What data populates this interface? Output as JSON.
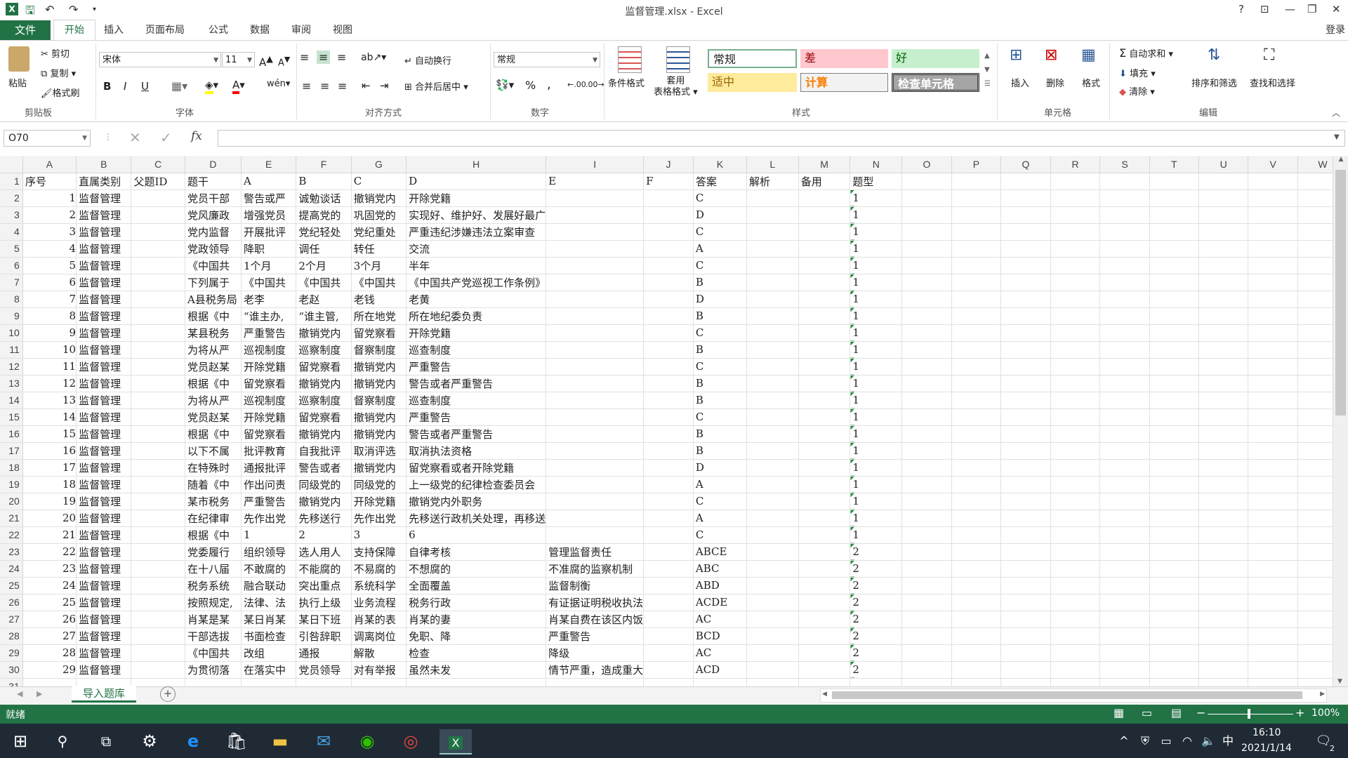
{
  "titlebar": {
    "title": "监督管理.xlsx - Excel",
    "help": "?",
    "minimize": "—",
    "restore": "❐",
    "close": "✕",
    "ribbon_display": "⊡"
  },
  "tabs": {
    "file": "文件",
    "home": "开始",
    "insert": "插入",
    "layout": "页面布局",
    "formulas": "公式",
    "data": "数据",
    "review": "审阅",
    "view": "视图",
    "login": "登录"
  },
  "ribbon": {
    "clipboard": {
      "paste": "粘贴",
      "cut": "剪切",
      "copy": "复制",
      "format_painter": "格式刷",
      "label": "剪贴板"
    },
    "font": {
      "name": "宋体",
      "size": "11",
      "bold": "B",
      "italic": "I",
      "underline": "U",
      "label": "字体",
      "wen": "wén"
    },
    "alignment": {
      "wrap": "自动换行",
      "merge": "合并后居中",
      "label": "对齐方式"
    },
    "number": {
      "format": "常规",
      "percent": "%",
      "comma": ",",
      "label": "数字"
    },
    "styles": {
      "conditional": "条件格式",
      "table_format": "套用\n表格格式",
      "normal": "常规",
      "bad": "差",
      "good": "好",
      "neutral": "适中",
      "calc": "计算",
      "check": "检查单元格",
      "label": "样式"
    },
    "cells": {
      "insert": "插入",
      "delete": "删除",
      "format": "格式",
      "label": "单元格"
    },
    "editing": {
      "autosum": "自动求和",
      "fill": "填充",
      "clear": "清除",
      "sort": "排序和筛选",
      "find": "查找和选择",
      "label": "编辑"
    }
  },
  "formula": {
    "namebox": "O70",
    "value": "",
    "fx": "fx"
  },
  "columns": [
    "A",
    "B",
    "C",
    "D",
    "E",
    "F",
    "G",
    "H",
    "I",
    "J",
    "K",
    "L",
    "M",
    "N",
    "O",
    "P",
    "Q",
    "R",
    "S",
    "T",
    "U",
    "V",
    "W"
  ],
  "header_row": [
    "序号",
    "直属类别",
    "父题ID",
    "题干",
    "A",
    "B",
    "C",
    "D",
    "E",
    "F",
    "答案",
    "解析",
    "备用",
    "题型"
  ],
  "rows": [
    [
      "1",
      "监督管理",
      "",
      "党员干部",
      "警告或严",
      "诚勉谈话",
      "撤销党内",
      "开除党籍",
      "",
      "",
      "C",
      "",
      "",
      "1"
    ],
    [
      "2",
      "监督管理",
      "",
      "党风廉政",
      "增强党员",
      "提高党的",
      "巩固党的",
      "实现好、维护好、发展好最广",
      "",
      "",
      "D",
      "",
      "",
      "1"
    ],
    [
      "3",
      "监督管理",
      "",
      "党内监督",
      "开展批评",
      "党纪轻处",
      "党纪重处",
      "严重违纪涉嫌违法立案审查",
      "",
      "",
      "C",
      "",
      "",
      "1"
    ],
    [
      "4",
      "监督管理",
      "",
      "党政领导",
      "降职",
      "调任",
      "转任",
      "交流",
      "",
      "",
      "A",
      "",
      "",
      "1"
    ],
    [
      "5",
      "监督管理",
      "",
      "《中国共",
      "1个月",
      "2个月",
      "3个月",
      "半年",
      "",
      "",
      "C",
      "",
      "",
      "1"
    ],
    [
      "6",
      "监督管理",
      "",
      "下列属于",
      "《中国共",
      "《中国共",
      "《中国共",
      "《中国共产党巡视工作条例》",
      "",
      "",
      "B",
      "",
      "",
      "1"
    ],
    [
      "7",
      "监督管理",
      "",
      "A县税务局",
      "老李",
      "老赵",
      "老钱",
      "老黄",
      "",
      "",
      "D",
      "",
      "",
      "1"
    ],
    [
      "8",
      "监督管理",
      "",
      "根据《中",
      "“谁主办,",
      "“谁主管,",
      "所在地党",
      "所在地纪委负责",
      "",
      "",
      "B",
      "",
      "",
      "1"
    ],
    [
      "9",
      "监督管理",
      "",
      "某县税务",
      "严重警告",
      "撤销党内",
      "留党察看",
      "开除党籍",
      "",
      "",
      "C",
      "",
      "",
      "1"
    ],
    [
      "10",
      "监督管理",
      "",
      "为将从严",
      "巡视制度",
      "巡察制度",
      "督察制度",
      "巡查制度",
      "",
      "",
      "B",
      "",
      "",
      "1"
    ],
    [
      "11",
      "监督管理",
      "",
      "党员赵某",
      "开除党籍",
      "留党察看",
      "撤销党内",
      "严重警告",
      "",
      "",
      "C",
      "",
      "",
      "1"
    ],
    [
      "12",
      "监督管理",
      "",
      "根据《中",
      "留党察看",
      "撤销党内",
      "撤销党内",
      "警告或者严重警告",
      "",
      "",
      "B",
      "",
      "",
      "1"
    ],
    [
      "13",
      "监督管理",
      "",
      "为将从严",
      "巡视制度",
      "巡察制度",
      "督察制度",
      "巡查制度",
      "",
      "",
      "B",
      "",
      "",
      "1"
    ],
    [
      "14",
      "监督管理",
      "",
      "党员赵某",
      "开除党籍",
      "留党察看",
      "撤销党内",
      "严重警告",
      "",
      "",
      "C",
      "",
      "",
      "1"
    ],
    [
      "15",
      "监督管理",
      "",
      "根据《中",
      "留党察看",
      "撤销党内",
      "撤销党内",
      "警告或者严重警告",
      "",
      "",
      "B",
      "",
      "",
      "1"
    ],
    [
      "16",
      "监督管理",
      "",
      "以下不属",
      "批评教育",
      "自我批评",
      "取消评选",
      "取消执法资格",
      "",
      "",
      "B",
      "",
      "",
      "1"
    ],
    [
      "17",
      "监督管理",
      "",
      "在特殊时",
      "通报批评",
      "警告或者",
      "撤销党内",
      "留党察看或者开除党籍",
      "",
      "",
      "D",
      "",
      "",
      "1"
    ],
    [
      "18",
      "监督管理",
      "",
      "随着《中",
      "作出问责",
      "同级党的",
      "同级党的",
      "上一级党的纪律检查委员会",
      "",
      "",
      "A",
      "",
      "",
      "1"
    ],
    [
      "19",
      "监督管理",
      "",
      "某市税务",
      "严重警告",
      "撤销党内",
      "开除党籍",
      "撤销党内外职务",
      "",
      "",
      "C",
      "",
      "",
      "1"
    ],
    [
      "20",
      "监督管理",
      "",
      "在纪律审",
      "先作出党",
      "先移送行",
      "先作出党",
      "先移送行政机关处理，再移送",
      "",
      "",
      "A",
      "",
      "",
      "1"
    ],
    [
      "21",
      "监督管理",
      "",
      "根据《中",
      "1",
      "2",
      "3",
      "6",
      "",
      "",
      "C",
      "",
      "",
      "1"
    ],
    [
      "22",
      "监督管理",
      "",
      "党委履行",
      "组织领导",
      "选人用人",
      "支持保障",
      "自律考核",
      "管理监督责任",
      "",
      "ABCE",
      "",
      "",
      "2"
    ],
    [
      "23",
      "监督管理",
      "",
      "在十八届",
      "不敢腐的",
      "不能腐的",
      "不易腐的",
      "不想腐的",
      "不准腐的监察机制",
      "",
      "ABC",
      "",
      "",
      "2"
    ],
    [
      "24",
      "监督管理",
      "",
      "税务系统",
      "融合联动",
      "突出重点",
      "系统科学",
      "全面覆盖",
      "监督制衡",
      "",
      "ABD",
      "",
      "",
      "2"
    ],
    [
      "25",
      "监督管理",
      "",
      "按照规定,",
      "法律、法",
      "执行上级",
      "业务流程",
      "税务行政",
      "有证据证明税收执法",
      "",
      "ACDE",
      "",
      "",
      "2"
    ],
    [
      "26",
      "监督管理",
      "",
      "肖某是某",
      "某日肖某",
      "某日下班",
      "肖某的表",
      "肖某的妻",
      "肖某自费在该区内饭",
      "",
      "AC",
      "",
      "",
      "2"
    ],
    [
      "27",
      "监督管理",
      "",
      "干部选拔",
      "书面检查",
      "引咎辞职",
      "调离岗位",
      "免职、降",
      "严重警告",
      "",
      "BCD",
      "",
      "",
      "2"
    ],
    [
      "28",
      "监督管理",
      "",
      "《中国共",
      "改组",
      "通报",
      "解散",
      "检查",
      "降级",
      "",
      "AC",
      "",
      "",
      "2"
    ],
    [
      "29",
      "监督管理",
      "",
      "为贯彻落",
      "在落实中",
      "党员领导",
      "对有举报",
      "虽然未发",
      "情节严重，造成重大",
      "",
      "ACD",
      "",
      "",
      "2"
    ]
  ],
  "sheettabs": {
    "active": "导入题库",
    "add": "+"
  },
  "status": {
    "ready": "就绪",
    "zoom": "100%",
    "minus": "−",
    "plus": "+"
  },
  "taskbar": {
    "time": "16:10",
    "date": "2021/1/14",
    "ime": "中",
    "notif": "2"
  }
}
